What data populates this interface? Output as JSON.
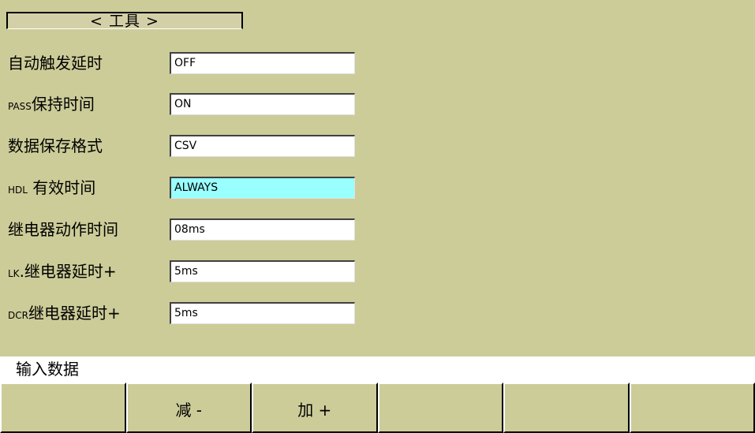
{
  "title": "< 工具 >",
  "settings": [
    {
      "label": "自动触发延时",
      "prefix": "",
      "value": "OFF",
      "selected": false
    },
    {
      "label": "保持时间",
      "prefix": "PASS",
      "value": "ON",
      "selected": false
    },
    {
      "label": "数据保存格式",
      "prefix": "",
      "value": "CSV",
      "selected": false
    },
    {
      "label": " 有效时间",
      "prefix": "HDL",
      "value": "ALWAYS",
      "selected": true
    },
    {
      "label": "继电器动作时间",
      "prefix": "",
      "value": "08ms",
      "selected": false
    },
    {
      "label": ".继电器延时+",
      "prefix": "LK",
      "value": "5ms",
      "selected": false
    },
    {
      "label": "继电器延时+",
      "prefix": "DCR",
      "value": "5ms",
      "selected": false
    }
  ],
  "status": {
    "text": "输入数据"
  },
  "softkeys": [
    {
      "label": ""
    },
    {
      "label": "减 -"
    },
    {
      "label": "加 +"
    },
    {
      "label": ""
    },
    {
      "label": ""
    },
    {
      "label": ""
    }
  ]
}
